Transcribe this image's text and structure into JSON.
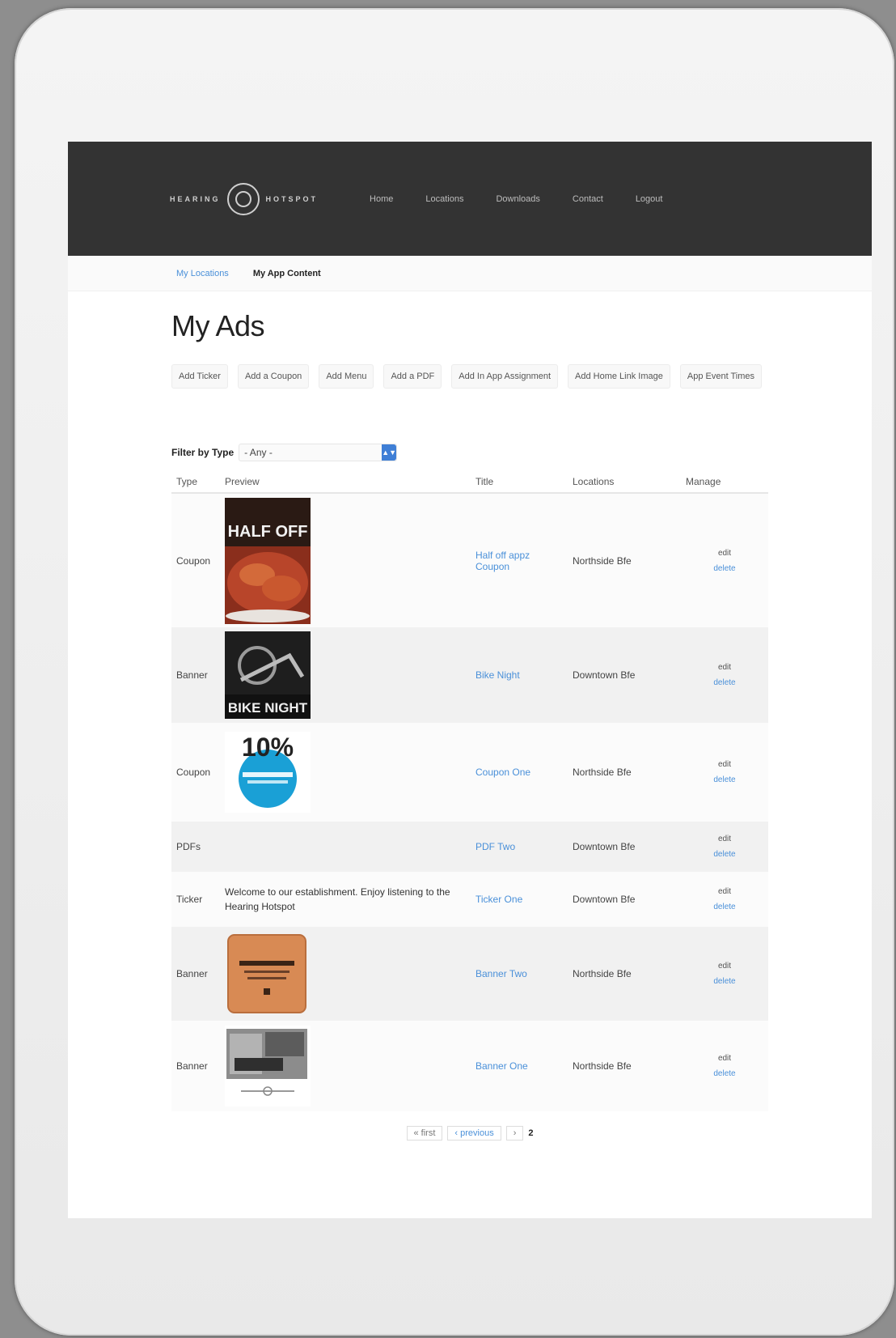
{
  "brand": {
    "left": "HEARING",
    "right": "HOTSPOT"
  },
  "topnav": [
    "Home",
    "Locations",
    "Downloads",
    "Contact",
    "Logout"
  ],
  "subnav": {
    "locations": "My Locations",
    "app_content": "My App Content"
  },
  "page_title": "My Ads",
  "actions": [
    "Add Ticker",
    "Add a Coupon",
    "Add Menu",
    "Add a PDF",
    "Add In App Assignment",
    "Add Home Link Image",
    "App Event Times"
  ],
  "filter": {
    "label": "Filter by Type",
    "value": "- Any -"
  },
  "table": {
    "headers": {
      "type": "Type",
      "preview": "Preview",
      "title": "Title",
      "locations": "Locations",
      "manage": "Manage"
    },
    "rows": [
      {
        "type": "Coupon",
        "preview": "image",
        "title": "Half off appz Coupon",
        "locations": "Northside Bfe",
        "edit": "edit",
        "delete": "delete"
      },
      {
        "type": "Banner",
        "preview": "image",
        "title": "Bike Night",
        "locations": "Downtown Bfe",
        "edit": "edit",
        "delete": "delete"
      },
      {
        "type": "Coupon",
        "preview": "image",
        "title": "Coupon One",
        "locations": "Northside Bfe",
        "edit": "edit",
        "delete": "delete"
      },
      {
        "type": "PDFs",
        "preview": "",
        "title": "PDF Two",
        "locations": "Downtown Bfe",
        "edit": "edit",
        "delete": "delete"
      },
      {
        "type": "Ticker",
        "preview": "Welcome to our establishment. Enjoy listening to the Hearing Hotspot",
        "title": "Ticker One",
        "locations": "Downtown Bfe",
        "edit": "edit",
        "delete": "delete"
      },
      {
        "type": "Banner",
        "preview": "image",
        "title": "Banner Two",
        "locations": "Northside Bfe",
        "edit": "edit",
        "delete": "delete"
      },
      {
        "type": "Banner",
        "preview": "image",
        "title": "Banner One",
        "locations": "Northside Bfe",
        "edit": "edit",
        "delete": "delete"
      }
    ]
  },
  "thumb_text": {
    "half_off": "HALF OFF",
    "bike_night": "BIKE NIGHT",
    "ten_percent": "10%"
  },
  "pager": {
    "prev": "« first",
    "prev2": "‹ previous",
    "next": "›",
    "current": "2"
  }
}
